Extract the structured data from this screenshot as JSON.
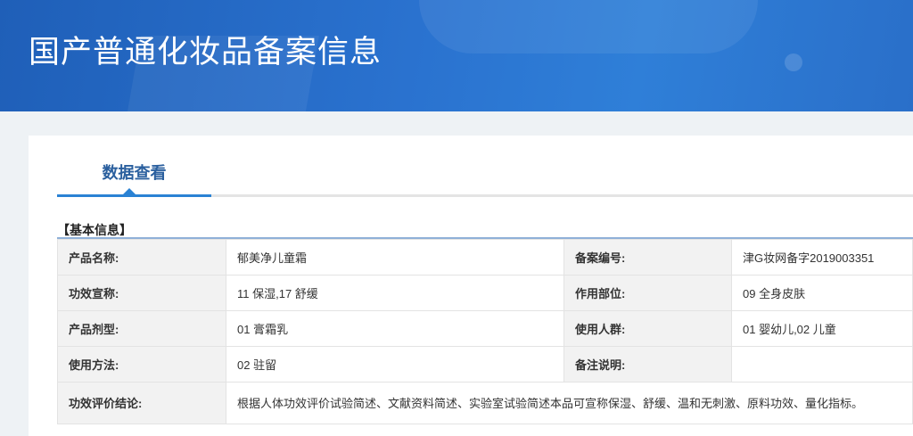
{
  "header": {
    "title": "国产普通化妆品备案信息"
  },
  "tabs": [
    {
      "label": "数据查看",
      "active": true
    }
  ],
  "section": {
    "title": "【基本信息】"
  },
  "rows": [
    {
      "l1": "产品名称:",
      "v1": "郁美净儿童霜",
      "l2": "备案编号:",
      "v2": "津G妆网备字2019003351"
    },
    {
      "l1": "功效宣称:",
      "v1": "11 保湿,17 舒缓",
      "l2": "作用部位:",
      "v2": "09 全身皮肤"
    },
    {
      "l1": "产品剂型:",
      "v1": "01 膏霜乳",
      "l2": "使用人群:",
      "v2": "01 婴幼儿,02 儿童"
    },
    {
      "l1": "使用方法:",
      "v1": "02 驻留",
      "l2": "备注说明:",
      "v2": ""
    }
  ],
  "conclusion": {
    "label": "功效评价结论:",
    "value": "根据人体功效评价试验简述、文献资料简述、实验室试验简述本品可宣称保湿、舒缓、温和无刺激、原料功效、量化指标。"
  }
}
